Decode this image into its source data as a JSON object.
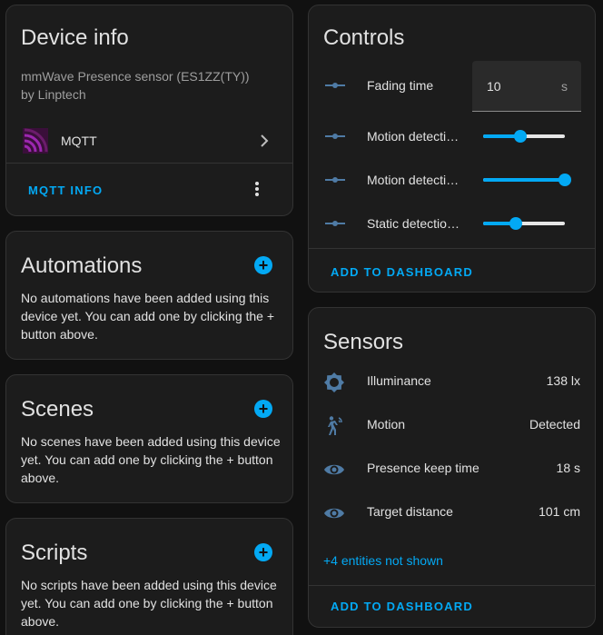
{
  "device_info": {
    "title": "Device info",
    "model": "mmWave Presence sensor (ES1ZZ(TY))",
    "manufacturer": "by Linptech",
    "integration": "MQTT",
    "mqtt_info_label": "MQTT INFO"
  },
  "automations": {
    "title": "Automations",
    "empty_text": "No automations have been added using this device yet. You can add one by clicking the + button above."
  },
  "scenes": {
    "title": "Scenes",
    "empty_text": "No scenes have been added using this device yet. You can add one by clicking the + button above."
  },
  "scripts": {
    "title": "Scripts",
    "empty_text": "No scripts have been added using this device yet. You can add one by clicking the + button above."
  },
  "controls": {
    "title": "Controls",
    "fading_time": {
      "label": "Fading time",
      "value": "10",
      "unit": "s"
    },
    "sliders": [
      {
        "label": "Motion detection sensitivity",
        "level": 0.45
      },
      {
        "label": "Motion detection distance",
        "level": 1.0
      },
      {
        "label": "Static detection sensitivity",
        "level": 0.4
      }
    ],
    "add_to_dashboard": "ADD TO DASHBOARD"
  },
  "sensors": {
    "title": "Sensors",
    "items": [
      {
        "label": "Illuminance",
        "value": "138 lx",
        "icon": "brightness-icon"
      },
      {
        "label": "Motion",
        "value": "Detected",
        "icon": "motion-sensor-icon"
      },
      {
        "label": "Presence keep time",
        "value": "18 s",
        "icon": "eye-icon"
      },
      {
        "label": "Target distance",
        "value": "101 cm",
        "icon": "eye-icon"
      }
    ],
    "more_entities": "+4 entities not shown",
    "add_to_dashboard": "ADD TO DASHBOARD"
  },
  "colors": {
    "accent": "#03a9f4",
    "card_bg": "#1c1c1c",
    "page_bg": "#111111",
    "icon": "#4f7ba5",
    "mqtt_logo": "#6b1c6b"
  }
}
